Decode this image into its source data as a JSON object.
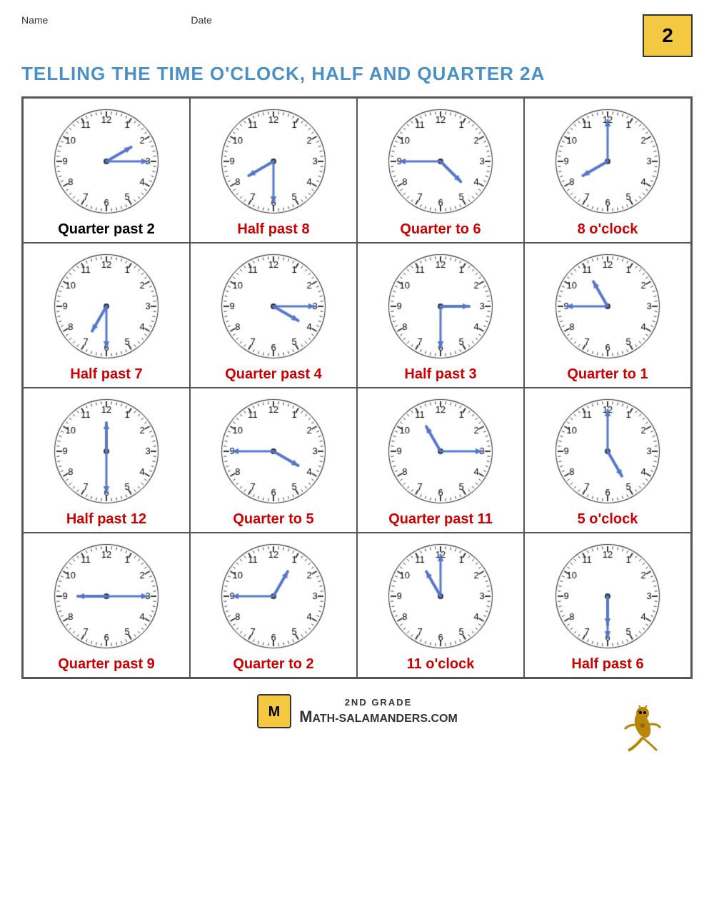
{
  "header": {
    "name_label": "Name",
    "date_label": "Date",
    "title": "TELLING THE TIME O'CLOCK, HALF AND QUARTER 2A",
    "grade": "2"
  },
  "clocks": [
    {
      "label": "Quarter past 2",
      "label_color": "black",
      "hour_angle": 60,
      "minute_angle": 90,
      "hour_len": 45,
      "minute_len": 60
    },
    {
      "label": "Half past 8",
      "label_color": "red",
      "hour_angle": 240,
      "minute_angle": 180,
      "hour_len": 45,
      "minute_len": 60
    },
    {
      "label": "Quarter to 6",
      "label_color": "red",
      "hour_angle": 135,
      "minute_angle": 270,
      "hour_len": 45,
      "minute_len": 60
    },
    {
      "label": "8 o'clock",
      "label_color": "red",
      "hour_angle": 240,
      "minute_angle": 0,
      "hour_len": 45,
      "minute_len": 60
    },
    {
      "label": "Half past 7",
      "label_color": "red",
      "hour_angle": 210,
      "minute_angle": 180,
      "hour_len": 45,
      "minute_len": 60
    },
    {
      "label": "Quarter past 4",
      "label_color": "red",
      "hour_angle": 120,
      "minute_angle": 90,
      "hour_len": 45,
      "minute_len": 60
    },
    {
      "label": "Half past 3",
      "label_color": "red",
      "hour_angle": 90,
      "minute_angle": 180,
      "hour_len": 45,
      "minute_len": 60
    },
    {
      "label": "Quarter to 1",
      "label_color": "red",
      "hour_angle": -30,
      "minute_angle": 270,
      "hour_len": 45,
      "minute_len": 60
    },
    {
      "label": "Half past 12",
      "label_color": "red",
      "hour_angle": 0,
      "minute_angle": 180,
      "hour_len": 45,
      "minute_len": 60
    },
    {
      "label": "Quarter to 5",
      "label_color": "red",
      "hour_angle": 120,
      "minute_angle": 270,
      "hour_len": 45,
      "minute_len": 60
    },
    {
      "label": "Quarter past 11",
      "label_color": "red",
      "hour_angle": -30,
      "minute_angle": 90,
      "hour_len": 45,
      "minute_len": 60
    },
    {
      "label": "5 o'clock",
      "label_color": "red",
      "hour_angle": 150,
      "minute_angle": 0,
      "hour_len": 45,
      "minute_len": 60
    },
    {
      "label": "Quarter past 9",
      "label_color": "red",
      "hour_angle": 270,
      "minute_angle": 90,
      "hour_len": 45,
      "minute_len": 60
    },
    {
      "label": "Quarter to 2",
      "label_color": "red",
      "hour_angle": 30,
      "minute_angle": 270,
      "hour_len": 45,
      "minute_len": 60
    },
    {
      "label": "11 o'clock",
      "label_color": "red",
      "hour_angle": -30,
      "minute_angle": 0,
      "hour_len": 45,
      "minute_len": 60
    },
    {
      "label": "Half past 6",
      "label_color": "red",
      "hour_angle": 180,
      "minute_angle": 180,
      "hour_len": 45,
      "minute_len": 60
    }
  ],
  "footer": {
    "grade_line": "2ND GRADE",
    "brand": "ATH-SALAMANDERS.COM"
  }
}
